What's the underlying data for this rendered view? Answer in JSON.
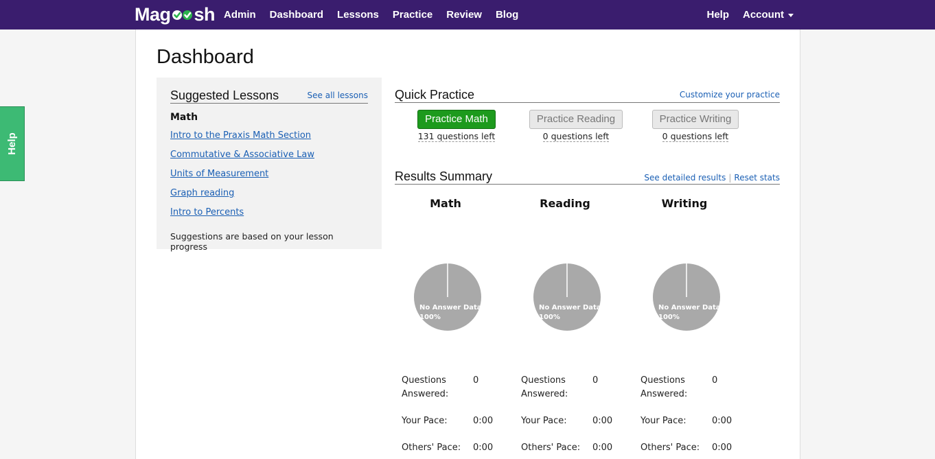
{
  "brand": {
    "name_start": "Mag",
    "name_end": "sh",
    "logo_icon": "double-checkmark-icon",
    "check_color": "#2bb24c"
  },
  "nav": {
    "left": [
      "Admin",
      "Dashboard",
      "Lessons",
      "Practice",
      "Review",
      "Blog"
    ],
    "help": "Help",
    "account": "Account"
  },
  "help_tab": "Help",
  "page_title": "Dashboard",
  "suggested": {
    "title": "Suggested Lessons",
    "see_all": "See all lessons",
    "subject": "Math",
    "lessons": [
      "Intro to the Praxis Math Section",
      "Commutative & Associative Law",
      "Units of Measurement",
      "Graph reading",
      "Intro to Percents"
    ],
    "note": "Suggestions are based on your lesson progress"
  },
  "quick_practice": {
    "title": "Quick Practice",
    "customize": "Customize your practice",
    "items": [
      {
        "label": "Practice Math",
        "left": "131 questions left",
        "active": true
      },
      {
        "label": "Practice Reading",
        "left": "0 questions left",
        "active": false
      },
      {
        "label": "Practice Writing",
        "left": "0 questions left",
        "active": false
      }
    ]
  },
  "results": {
    "title": "Results Summary",
    "detailed": "See detailed results",
    "reset": "Reset stats",
    "columns": [
      {
        "subject": "Math",
        "pie_label": "No Answer Data",
        "pie_pct": "100%",
        "pie_fraction": 1.0,
        "stats": [
          {
            "label": "Questions Answered:",
            "value": "0"
          },
          {
            "label": "Your Pace:",
            "value": "0:00"
          },
          {
            "label": "Others' Pace:",
            "value": "0:00"
          }
        ]
      },
      {
        "subject": "Reading",
        "pie_label": "No Answer Data",
        "pie_pct": "100%",
        "pie_fraction": 1.0,
        "stats": [
          {
            "label": "Questions Answered:",
            "value": "0"
          },
          {
            "label": "Your Pace:",
            "value": "0:00"
          },
          {
            "label": "Others' Pace:",
            "value": "0:00"
          }
        ]
      },
      {
        "subject": "Writing",
        "pie_label": "No Answer Data",
        "pie_pct": "100%",
        "pie_fraction": 1.0,
        "stats": [
          {
            "label": "Questions Answered:",
            "value": "0"
          },
          {
            "label": "Your Pace:",
            "value": "0:00"
          },
          {
            "label": "Others' Pace:",
            "value": "0:00"
          }
        ]
      }
    ],
    "pie_color": "#a9a9a9"
  },
  "colors": {
    "topbar": "#3a1d6e",
    "help_tab": "#3dba74",
    "primary_button": "#1d9a1d",
    "link": "#1a5fb4"
  }
}
